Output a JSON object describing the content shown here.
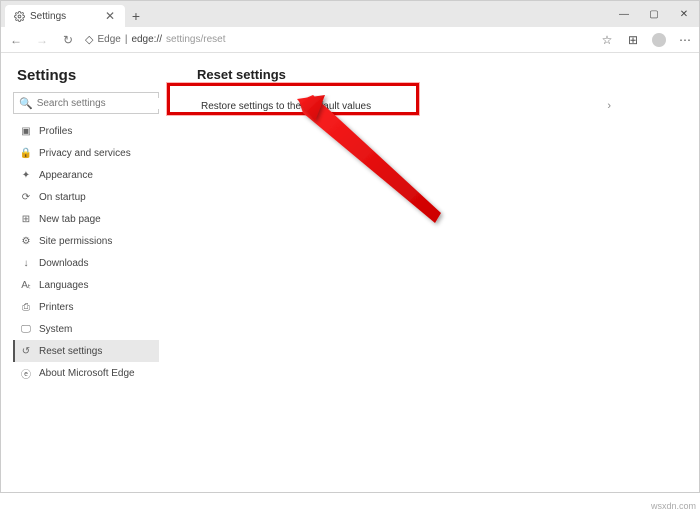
{
  "tab": {
    "title": "Settings"
  },
  "window_controls": {
    "min": "—",
    "max": "▢",
    "close": "✕"
  },
  "address": {
    "secure_label": "Edge",
    "host": "edge://",
    "path": "settings/reset"
  },
  "sidebar": {
    "title": "Settings",
    "search_placeholder": "Search settings",
    "items": [
      {
        "icon": "profiles-icon",
        "glyph": "▣",
        "label": "Profiles"
      },
      {
        "icon": "privacy-icon",
        "glyph": "🔒",
        "label": "Privacy and services"
      },
      {
        "icon": "appearance-icon",
        "glyph": "✦",
        "label": "Appearance"
      },
      {
        "icon": "startup-icon",
        "glyph": "⟳",
        "label": "On startup"
      },
      {
        "icon": "newtab-icon",
        "glyph": "⊞",
        "label": "New tab page"
      },
      {
        "icon": "permissions-icon",
        "glyph": "⚙",
        "label": "Site permissions"
      },
      {
        "icon": "downloads-icon",
        "glyph": "↓",
        "label": "Downloads"
      },
      {
        "icon": "languages-icon",
        "glyph": "Aₜ",
        "label": "Languages"
      },
      {
        "icon": "printers-icon",
        "glyph": "⎙",
        "label": "Printers"
      },
      {
        "icon": "system-icon",
        "glyph": "🖵",
        "label": "System"
      },
      {
        "icon": "reset-icon",
        "glyph": "↺",
        "label": "Reset settings"
      },
      {
        "icon": "about-icon",
        "glyph": "ⓔ",
        "label": "About Microsoft Edge"
      }
    ]
  },
  "main": {
    "heading": "Reset settings",
    "restore_label": "Restore settings to their default values"
  },
  "watermark": "wsxdn.com"
}
